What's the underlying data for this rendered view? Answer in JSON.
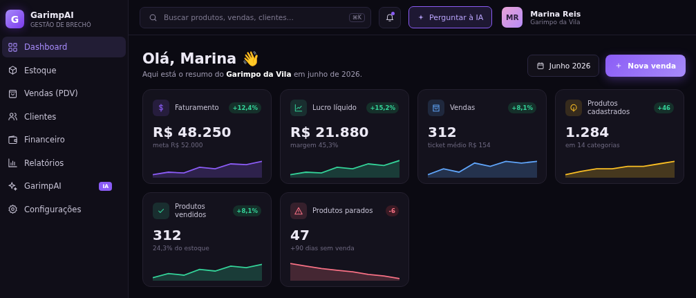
{
  "brand": {
    "logo": "G",
    "name": "GarimpAI",
    "tagline": "GESTÃO DE BRECHÓ"
  },
  "nav": [
    {
      "label": "Dashboard",
      "selected": true
    },
    {
      "label": "Estoque",
      "selected": false
    },
    {
      "label": "Vendas (PDV)",
      "selected": false
    },
    {
      "label": "Clientes",
      "selected": false
    },
    {
      "label": "Financeiro",
      "selected": false
    },
    {
      "label": "Relatórios",
      "selected": false
    },
    {
      "label": "GarimpAI",
      "selected": false,
      "badge": "IA"
    },
    {
      "label": "Configurações",
      "selected": false
    }
  ],
  "topbar": {
    "search": {
      "placeholder": "Buscar produtos, vendas, clientes...",
      "shortcut": "⌘K"
    },
    "notifications": {
      "unread": true
    },
    "ask_button": "Perguntar à IA",
    "user": {
      "initials": "MR",
      "name": "Marina Reis",
      "store": "Garimpo da Vila"
    }
  },
  "header": {
    "greeting": "Olá, Marina 👋",
    "summary": "Aqui está o resumo do **Garimpo da Vila** em junho de 2026.",
    "period_button": "Junho 2026",
    "new_sale_button": "Nova venda"
  },
  "cards": [
    {
      "title": "Faturamento",
      "color": "#8b5cf6",
      "change": "+12,4%",
      "kind": "up",
      "value": "R$ 48.250",
      "note": "meta R$ 52.000"
    },
    {
      "title": "Lucro líquido",
      "color": "#34d399",
      "change": "+15,2%",
      "kind": "up",
      "value": "R$ 21.880",
      "note": "margem 45,3%"
    },
    {
      "title": "Vendas",
      "color": "#60a5fa",
      "change": "+8,1%",
      "kind": "up",
      "value": "312",
      "note": "ticket médio R$ 154"
    },
    {
      "title": "Produtos cadastrados",
      "color": "#fbbf24",
      "change": "+46",
      "kind": "up",
      "value": "1.284",
      "note": "em 14 categorias"
    },
    {
      "title": "Produtos vendidos",
      "color": "#34d399",
      "change": "+8,1%",
      "kind": "up",
      "value": "312",
      "note": "24,3% do estoque"
    },
    {
      "title": "Produtos parados",
      "color": "#f87185",
      "change": "-6",
      "kind": "down",
      "value": "47",
      "note": "+90 dias sem venda"
    }
  ]
}
